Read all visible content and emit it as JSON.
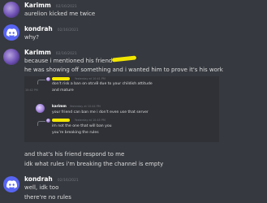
{
  "messages": [
    {
      "author": "Karimm",
      "timestamp": "02/16/2021",
      "lines": [
        "aurelion kicked me twice"
      ]
    },
    {
      "author": "kondrah",
      "timestamp": "02/16/2021",
      "lines": [
        "why?"
      ]
    },
    {
      "author": "Karimm",
      "timestamp": "02/16/2021",
      "lines": [
        "because i mentioned his friend",
        "he was showing off something and i wanted him to prove it's his work"
      ]
    },
    {
      "author": "kondrah",
      "timestamp": "02/16/2021",
      "lines": [
        "well, idk too",
        "there're no rules"
      ]
    }
  ],
  "continuation_lines": [
    "and that's his friend respond to me",
    "idk what rules i'm breaking the channel is empty"
  ],
  "embedded": {
    "reply1": {
      "timestamp": "Yesterday at 10:41 PM",
      "line": "don't risk a ban on otcv8 due to your childish attitude",
      "side_time": "10:42 PM",
      "side_line": "and mature"
    },
    "karimm_msg": {
      "author": "karimm",
      "timestamp": "Yesterday at 10:44 PM",
      "line": "your friend can ban me i don't even use that server"
    },
    "reply2": {
      "timestamp": "Yesterday at 10:45 PM",
      "lines": [
        "im not the one that will ban you",
        "you're breaking the rules"
      ]
    }
  }
}
